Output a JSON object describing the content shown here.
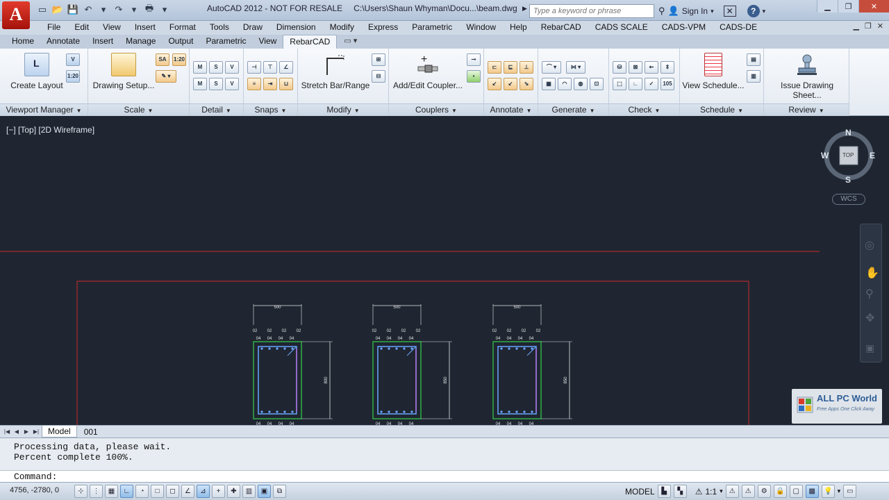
{
  "titlebar": {
    "app_logo": "A",
    "title_product": "AutoCAD 2012 - NOT FOR RESALE",
    "title_file": "C:\\Users\\Shaun Whyman\\Docu...\\beam.dwg",
    "search_placeholder": "Type a keyword or phrase",
    "sign_in": "Sign In"
  },
  "menubar": {
    "items": [
      "File",
      "Edit",
      "View",
      "Insert",
      "Format",
      "Tools",
      "Draw",
      "Dimension",
      "Modify",
      "Express",
      "Parametric",
      "Window",
      "Help",
      "RebarCAD",
      "CADS SCALE",
      "CADS-VPM",
      "CADS-DE"
    ]
  },
  "ribbon_tabs": {
    "items": [
      "Home",
      "Annotate",
      "Insert",
      "Manage",
      "Output",
      "Parametric",
      "View",
      "RebarCAD"
    ],
    "active": "RebarCAD"
  },
  "ribbon": {
    "viewport_manager": {
      "footer": "Viewport Manager",
      "create_layout": "Create Layout",
      "btn_v": "V",
      "btn_120": "1:20"
    },
    "scale": {
      "footer": "Scale",
      "drawing_setup": "Drawing Setup...",
      "btn_sa": "SA",
      "btn_120": "1:20"
    },
    "detail": {
      "footer": "Detail",
      "icons": [
        "M",
        "S",
        "V",
        "M",
        "S",
        "V"
      ]
    },
    "snaps": {
      "footer": "Snaps"
    },
    "modify": {
      "footer": "Modify",
      "stretch": "Stretch Bar/Range"
    },
    "couplers": {
      "footer": "Couplers",
      "add_edit": "Add/Edit Coupler..."
    },
    "annotate": {
      "footer": "Annotate"
    },
    "generate": {
      "footer": "Generate"
    },
    "check": {
      "footer": "Check",
      "btn_105": "105"
    },
    "schedule": {
      "footer": "Schedule",
      "view_schedule": "View Schedule..."
    },
    "review": {
      "footer": "Review",
      "issue": "Issue Drawing Sheet..."
    }
  },
  "drawing": {
    "viewport_label": "[−] [Top] [2D Wireframe]",
    "viewcube": {
      "n": "N",
      "s": "S",
      "e": "E",
      "w": "W",
      "face": "TOP"
    },
    "wcs": "WCS",
    "sections": [
      {
        "width_dim": "500",
        "height_dim": "800",
        "top_labels": [
          "02",
          "02",
          "02",
          "02"
        ],
        "top_labels2": [
          "04",
          "04",
          "04",
          "04"
        ],
        "bottom_labels": [
          "04",
          "04",
          "04",
          "04"
        ]
      },
      {
        "width_dim": "500",
        "height_dim": "850",
        "top_labels": [
          "02",
          "02",
          "02",
          "02"
        ],
        "top_labels2": [
          "04",
          "04",
          "04",
          "04"
        ],
        "bottom_labels": [
          "04",
          "04",
          "04",
          "04"
        ]
      },
      {
        "width_dim": "500",
        "height_dim": "850",
        "top_labels": [
          "02",
          "02",
          "02",
          "02"
        ],
        "top_labels2": [
          "04",
          "04",
          "04",
          "04"
        ],
        "bottom_labels": [
          "04",
          "04",
          "04",
          "04"
        ]
      }
    ],
    "colors": {
      "background": "#1f2631",
      "red_line": "#cc2b2b",
      "section_outline": "#34d24a",
      "stirrup": "#6aa7ff",
      "link": "#c86cf0",
      "dims": "#e8e8e8"
    }
  },
  "watermark": {
    "title": "ALL PC World",
    "subtitle": "Free Apps One Click Away"
  },
  "layout_tabs": {
    "items": [
      "Model",
      "001"
    ],
    "active": "Model"
  },
  "command": {
    "history": [
      "Processing data, please wait.",
      "Percent complete 100%."
    ],
    "prompt": "Command:"
  },
  "statusbar": {
    "coords": "4756, -2780, 0",
    "model": "MODEL",
    "scale": "1:1"
  }
}
